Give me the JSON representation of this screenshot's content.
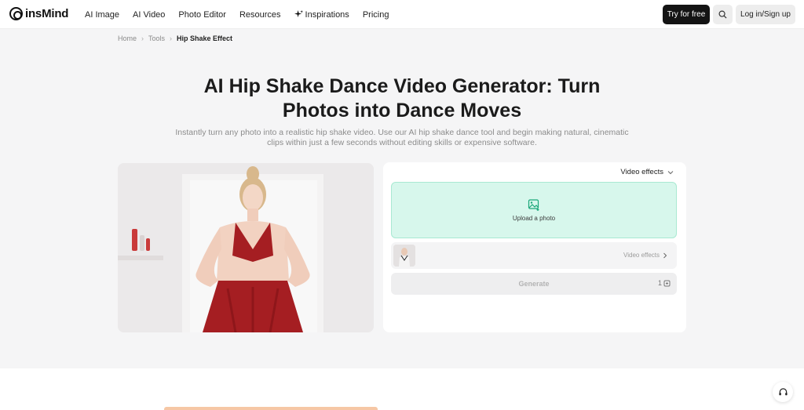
{
  "brand": {
    "name": "insMind"
  },
  "nav": {
    "items": [
      {
        "label": "AI Image"
      },
      {
        "label": "AI Video"
      },
      {
        "label": "Photo Editor"
      },
      {
        "label": "Resources"
      },
      {
        "label": "Inspirations"
      },
      {
        "label": "Pricing"
      }
    ],
    "try_label": "Try for free",
    "login_label": "Log in/Sign up"
  },
  "breadcrumb": {
    "home": "Home",
    "tools": "Tools",
    "current": "Hip Shake Effect"
  },
  "hero": {
    "title_line1": "AI Hip Shake Dance Video Generator: Turn",
    "title_line2": "Photos into Dance Moves",
    "subtitle_line1": "Instantly turn any photo into a realistic hip shake video. Use our AI hip shake dance tool and begin making natural, cinematic",
    "subtitle_line2": "clips within just a few seconds without editing skills or expensive software."
  },
  "tool": {
    "effects_dropdown": "Video effects",
    "upload_label": "Upload a photo",
    "effect_row_label": "Video effects",
    "generate_label": "Generate",
    "credits": "1"
  },
  "colors": {
    "accent": "#d7f7ec",
    "dress": "#a51e22",
    "primary_btn": "#141414"
  },
  "icons": [
    "logo-icon",
    "sparkle-icon",
    "search-icon",
    "chevron-down-icon",
    "image-upload-icon",
    "chevron-right-icon",
    "credit-icon",
    "headset-icon"
  ]
}
